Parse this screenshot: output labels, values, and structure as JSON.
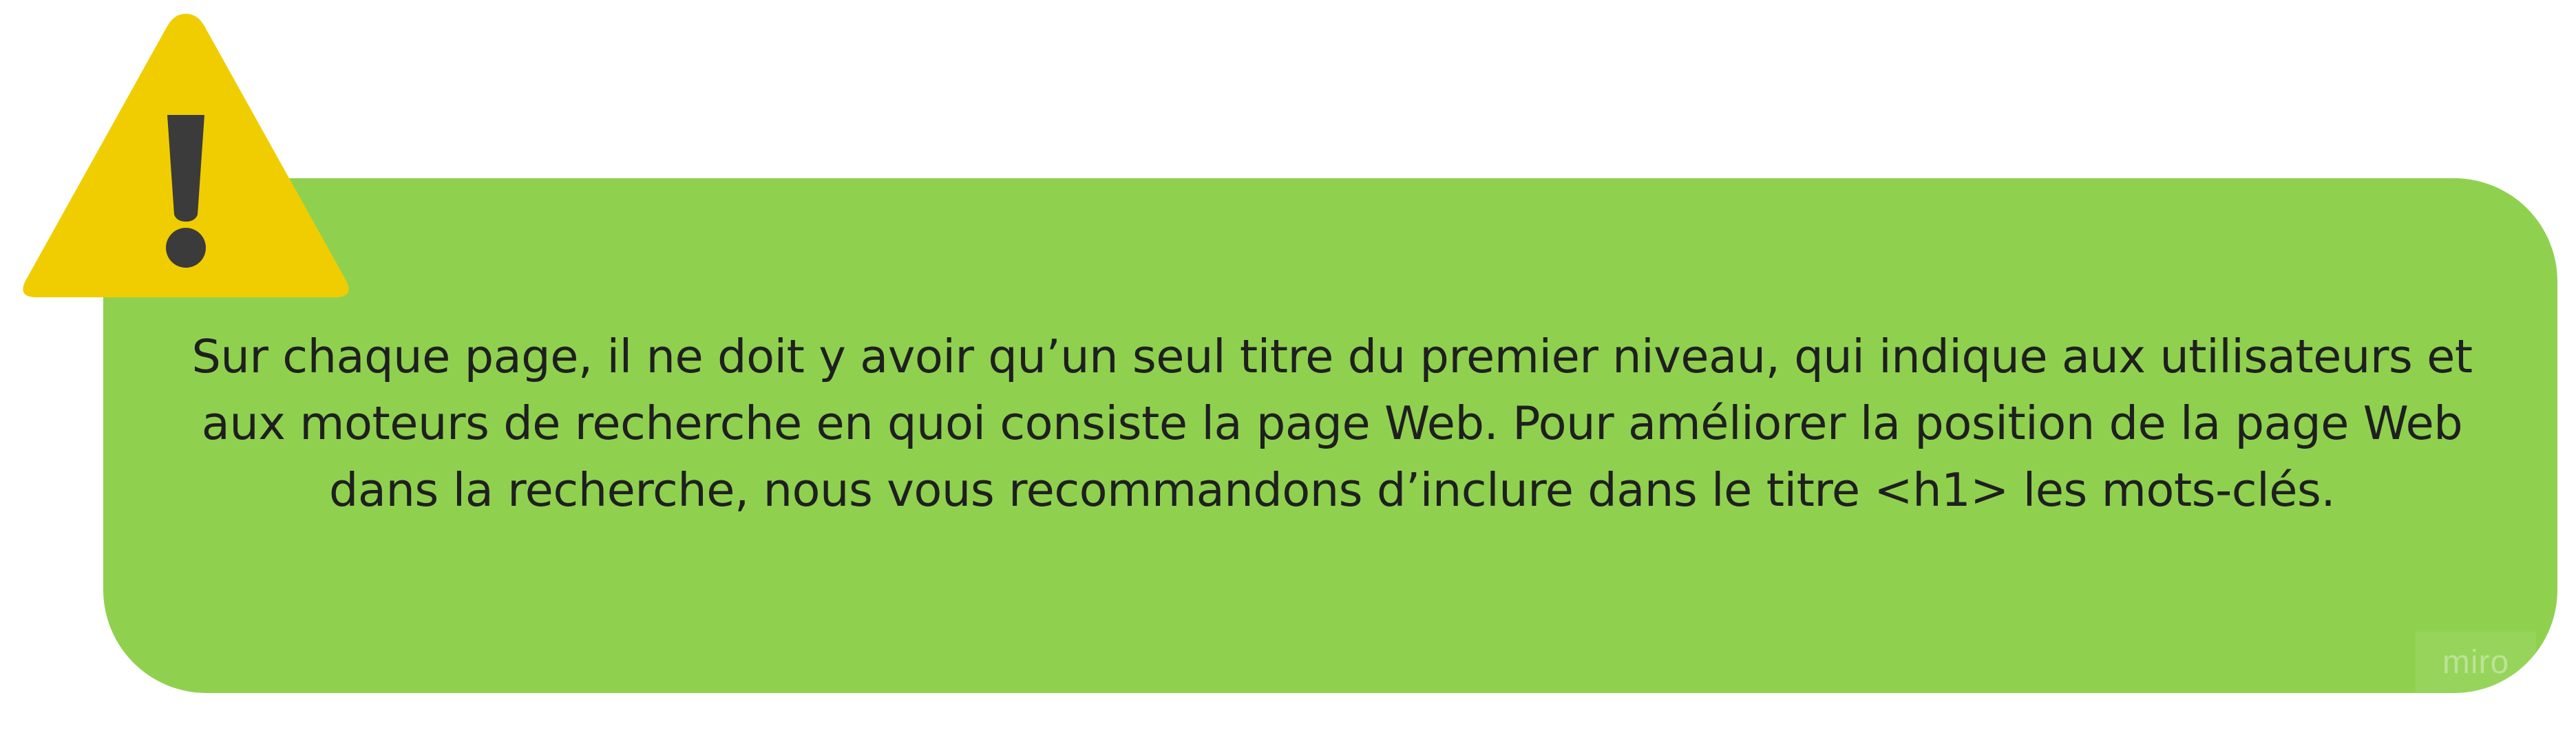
{
  "colors": {
    "box_background": "#8fd14f",
    "warning_fill": "#f0cd00",
    "warning_glyph": "#3b3b3b",
    "text": "#1f1f1f"
  },
  "icons": {
    "warning": "warning-triangle-icon"
  },
  "callout": {
    "text": "Sur chaque page, il ne doit y avoir qu’un seul titre du premier niveau, qui indique aux utilisateurs et aux moteurs de recherche en quoi consiste la page Web. Pour améliorer la position de la page Web dans la recherche, nous vous recommandons d’inclure dans le titre <h1> les mots-clés."
  },
  "watermark": {
    "text": "miro"
  }
}
